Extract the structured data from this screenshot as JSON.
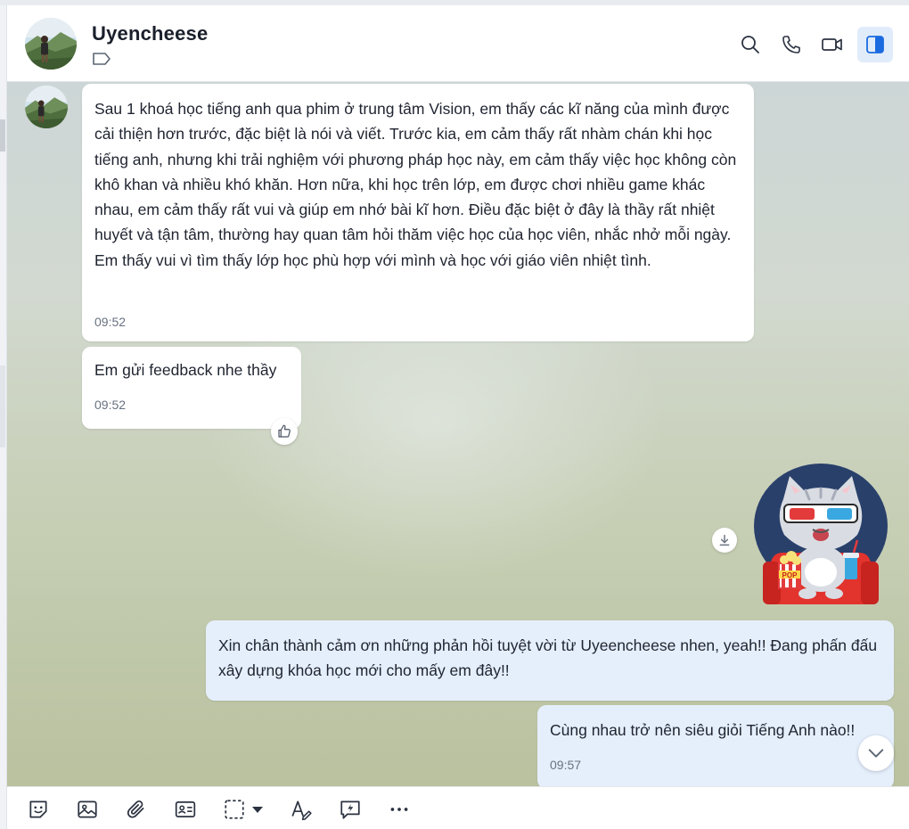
{
  "header": {
    "contact_name": "Uyencheese",
    "icons": [
      "search-icon",
      "phone-icon",
      "video-icon",
      "sidebar-toggle-icon",
      "label-tag-icon"
    ]
  },
  "messages": [
    {
      "direction": "incoming",
      "text": "Sau 1 khoá học tiếng anh qua phim ở trung tâm Vision, em thấy các kĩ năng của mình được cải thiện hơn trước, đặc biệt là nói và viết. Trước kia, em cảm thấy rất nhàm chán khi học tiếng anh, nhưng khi trải nghiệm với phương pháp học này, em cảm thấy việc học không còn khô khan và nhiều khó khăn. Hơn nữa, khi học trên lớp, em được chơi nhiều game khác nhau, em cảm thấy rất vui và giúp em nhớ bài kĩ hơn. Điều đặc biệt ở đây là thầy rất nhiệt huyết và tận tâm, thường hay quan tâm hỏi thăm việc học của học viên, nhắc nhở mỗi ngày.  Em thấy vui vì tìm thấy lớp học phù hợp với mình và học với giáo viên nhiệt tình.",
      "time": "09:52"
    },
    {
      "direction": "incoming",
      "text": "Em gửi feedback nhe thầy",
      "time": "09:52"
    },
    {
      "direction": "outgoing",
      "sticker": "cat-with-3d-glasses-popcorn-sticker",
      "sticker_text": "POP"
    },
    {
      "direction": "outgoing",
      "text": "Xin chân thành cảm ơn những phản hồi tuyệt vời từ Uyeencheese nhen, yeah!! Đang phấn đấu xây dựng khóa học mới cho mấy em đây!!"
    },
    {
      "direction": "outgoing",
      "text": "Cùng nhau trở nên siêu giỏi Tiếng Anh nào!!",
      "time": "09:57"
    }
  ],
  "toolbar": {
    "icons": [
      "sticker-icon",
      "image-icon",
      "attachment-icon",
      "contact-card-icon",
      "screenshot-icon",
      "dropdown-arrow-icon",
      "text-format-icon",
      "quick-message-icon",
      "more-icon"
    ]
  },
  "colors": {
    "incoming_bubble": "#ffffff",
    "outgoing_bubble": "#e5effc",
    "accent": "#1a6be0",
    "header_text": "#1a1f2b"
  }
}
